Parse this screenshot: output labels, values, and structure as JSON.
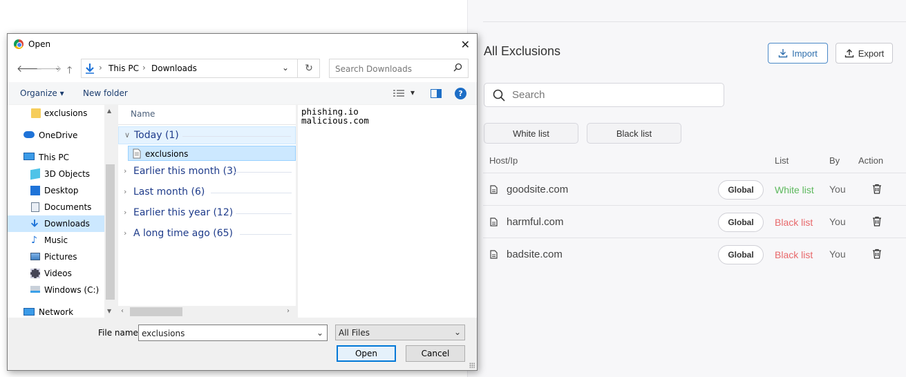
{
  "app_panel": {
    "title": "All Exclusions",
    "import_label": "Import",
    "export_label": "Export",
    "search_placeholder": "Search",
    "filters": [
      "White list",
      "Black list"
    ],
    "columns": {
      "host": "Host/Ip",
      "list": "List",
      "by": "By",
      "action": "Action"
    },
    "rows": [
      {
        "host": "goodsite.com",
        "scope": "Global",
        "list": "White list",
        "list_color": "#5cb85c",
        "by": "You"
      },
      {
        "host": "harmful.com",
        "scope": "Global",
        "list": "Black list",
        "list_color": "#e8686a",
        "by": "You"
      },
      {
        "host": "badsite.com",
        "scope": "Global",
        "list": "Black list",
        "list_color": "#e8686a",
        "by": "You"
      }
    ]
  },
  "dialog": {
    "title": "Open",
    "breadcrumbs": [
      "This PC",
      "Downloads"
    ],
    "search_placeholder": "Search Downloads",
    "organize_label": "Organize",
    "new_folder_label": "New folder",
    "nav_items": [
      {
        "label": "exclusions",
        "icon": "folder-icon"
      },
      {
        "label": "OneDrive",
        "icon": "cloud-icon"
      },
      {
        "label": "This PC",
        "icon": "computer-icon"
      },
      {
        "label": "3D Objects",
        "icon": "cube-icon"
      },
      {
        "label": "Desktop",
        "icon": "desktop-icon"
      },
      {
        "label": "Documents",
        "icon": "documents-icon"
      },
      {
        "label": "Downloads",
        "icon": "download-icon",
        "selected": true
      },
      {
        "label": "Music",
        "icon": "music-icon"
      },
      {
        "label": "Pictures",
        "icon": "pictures-icon"
      },
      {
        "label": "Videos",
        "icon": "videos-icon"
      },
      {
        "label": "Windows (C:)",
        "icon": "drive-icon"
      },
      {
        "label": "Network",
        "icon": "network-icon"
      }
    ],
    "column_name": "Name",
    "groups": [
      {
        "label": "Today (1)",
        "expanded": true
      },
      {
        "label": "Earlier this month (3)",
        "expanded": false
      },
      {
        "label": "Last month (6)",
        "expanded": false
      },
      {
        "label": "Earlier this year (12)",
        "expanded": false
      },
      {
        "label": "A long time ago (65)",
        "expanded": false
      }
    ],
    "selected_file": "exclusions",
    "preview_lines": [
      "phishing.io",
      "malicious.com"
    ],
    "file_name_label": "File name:",
    "file_name_value": "exclusions",
    "file_type_value": "All Files",
    "open_label": "Open",
    "cancel_label": "Cancel"
  }
}
